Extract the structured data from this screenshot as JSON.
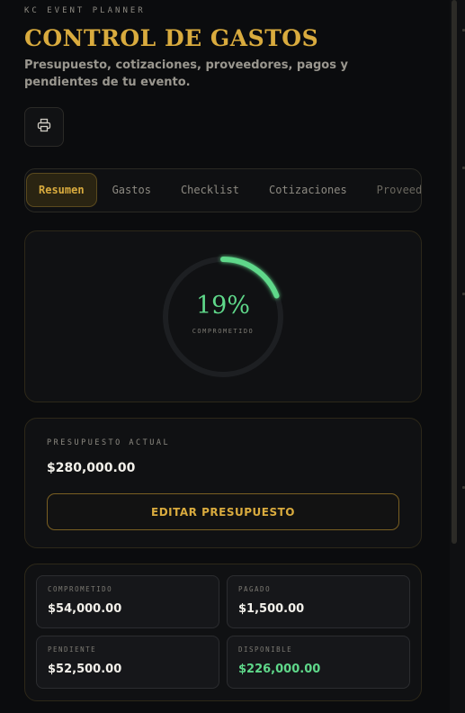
{
  "header": {
    "eyebrow": "KC EVENT PLANNER",
    "title": "CONTROL DE GASTOS",
    "subtitle": "Presupuesto, cotizaciones, proveedores, pagos y pendientes de tu evento.",
    "print_icon": "printer-icon"
  },
  "tabs": [
    {
      "label": "Resumen",
      "active": true
    },
    {
      "label": "Gastos",
      "active": false
    },
    {
      "label": "Checklist",
      "active": false
    },
    {
      "label": "Cotizaciones",
      "active": false
    },
    {
      "label": "Proveedores",
      "active": false
    }
  ],
  "gauge": {
    "percent_text": "19%",
    "percent_value": 19,
    "label": "COMPROMETIDO",
    "color": "#5fd88a"
  },
  "budget": {
    "label": "PRESUPUESTO ACTUAL",
    "value": "$280,000.00",
    "edit_label": "EDITAR PRESUPUESTO"
  },
  "stats": [
    {
      "label": "COMPROMETIDO",
      "value": "$54,000.00"
    },
    {
      "label": "PAGADO",
      "value": "$1,500.00"
    },
    {
      "label": "PENDIENTE",
      "value": "$52,500.00"
    },
    {
      "label": "DISPONIBLE",
      "value": "$226,000.00",
      "color": "#5fd88a"
    }
  ],
  "colors": {
    "accent": "#d9ab3e",
    "positive": "#5fd88a",
    "background": "#0b0c0e"
  }
}
